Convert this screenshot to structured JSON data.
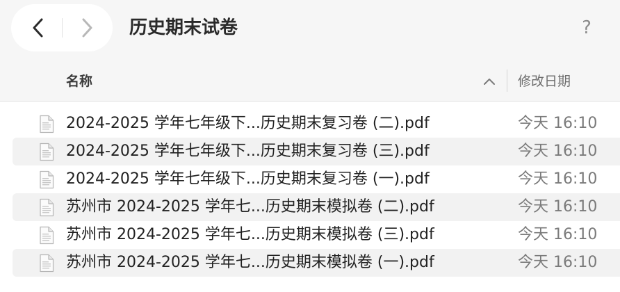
{
  "window": {
    "title": "历史期末试卷",
    "help_label": "?"
  },
  "navigation": {
    "back_icon": "chevron-left-icon",
    "forward_icon": "chevron-right-icon"
  },
  "columns": {
    "name_label": "名称",
    "date_label": "修改日期",
    "sort_icon": "chevron-up-icon"
  },
  "files": [
    {
      "name": "2024-2025 学年七年级下...历史期末复习卷 (二).pdf",
      "date": "今天 16:10",
      "icon": "pdf-file-icon"
    },
    {
      "name": "2024-2025 学年七年级下...历史期末复习卷 (三).pdf",
      "date": "今天 16:10",
      "icon": "pdf-file-icon"
    },
    {
      "name": "2024-2025 学年七年级下...历史期末复习卷 (一).pdf",
      "date": "今天 16:10",
      "icon": "pdf-file-icon"
    },
    {
      "name": "苏州市 2024-2025 学年七...历史期末模拟卷 (二).pdf",
      "date": "今天 16:10",
      "icon": "pdf-file-icon"
    },
    {
      "name": "苏州市 2024-2025 学年七...历史期末模拟卷 (三).pdf",
      "date": "今天 16:10",
      "icon": "pdf-file-icon"
    },
    {
      "name": "苏州市 2024-2025 学年七...历史期末模拟卷 (一).pdf",
      "date": "今天 16:10",
      "icon": "pdf-file-icon"
    }
  ],
  "colors": {
    "toolbar_bg": "#f6f6f6",
    "stripe_bg": "#f2f2f2",
    "text_primary": "#222222",
    "text_secondary": "#7a7a7a"
  }
}
